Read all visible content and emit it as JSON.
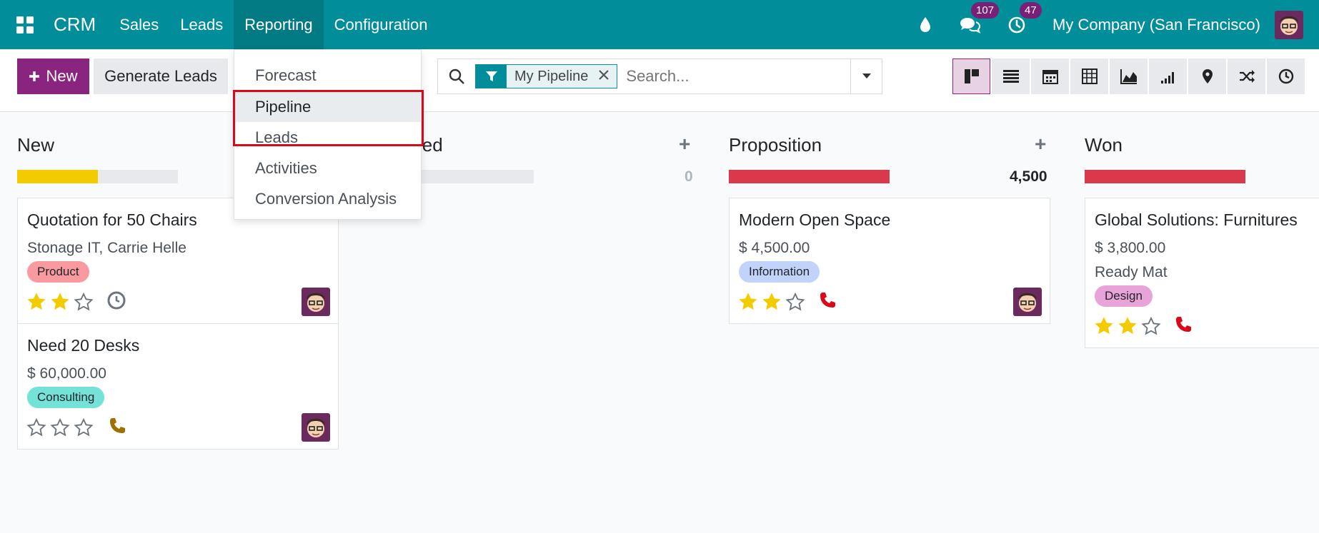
{
  "navbar": {
    "brand": "CRM",
    "menu": [
      "Sales",
      "Leads",
      "Reporting",
      "Configuration"
    ],
    "messages_count": "107",
    "activities_count": "47",
    "company": "My Company (San Francisco)"
  },
  "control": {
    "new_label": "New",
    "generate_label": "Generate Leads",
    "facet_label": "My Pipeline",
    "search_placeholder": "Search..."
  },
  "dropdown": {
    "items": [
      "Forecast",
      "Pipeline",
      "Leads",
      "Activities",
      "Conversion Analysis"
    ]
  },
  "columns": [
    {
      "title": "New",
      "sum": "",
      "progress_fraction": 0.5,
      "progress_color": "#f3cc00"
    },
    {
      "title": "Qualified",
      "title_visible": "ied",
      "sum": "0",
      "progress_fraction": 0,
      "progress_color": "#e7e9ed"
    },
    {
      "title": "Proposition",
      "sum": "4,500",
      "progress_fraction": 1,
      "progress_color": "#d9394a"
    },
    {
      "title": "Won",
      "sum": "",
      "progress_fraction": 1,
      "progress_color": "#d9394a"
    }
  ],
  "cards": {
    "c1": {
      "title": "Quotation for 50 Chairs",
      "line1": "Stonage IT, Carrie Helle",
      "tag": "Product",
      "tag_color": "#f99aa0",
      "stars": 2,
      "activity": "clock-icon"
    },
    "c2": {
      "title": "Need 20 Desks",
      "line1": "$ 60,000.00",
      "tag": "Consulting",
      "tag_color": "#74e2d7",
      "stars": 0,
      "activity": "phone-icon"
    },
    "c3": {
      "title": "Modern Open Space",
      "line1": "$ 4,500.00",
      "tag": "Information",
      "tag_color": "#c2d3fb",
      "stars": 2,
      "activity": "phone-icon"
    },
    "c4": {
      "title": "Global Solutions: Furnitures",
      "line1": "$ 3,800.00",
      "line2": "Ready Mat",
      "tag": "Design",
      "tag_color": "#e8a4d8",
      "stars": 2,
      "activity": "phone-icon"
    }
  }
}
